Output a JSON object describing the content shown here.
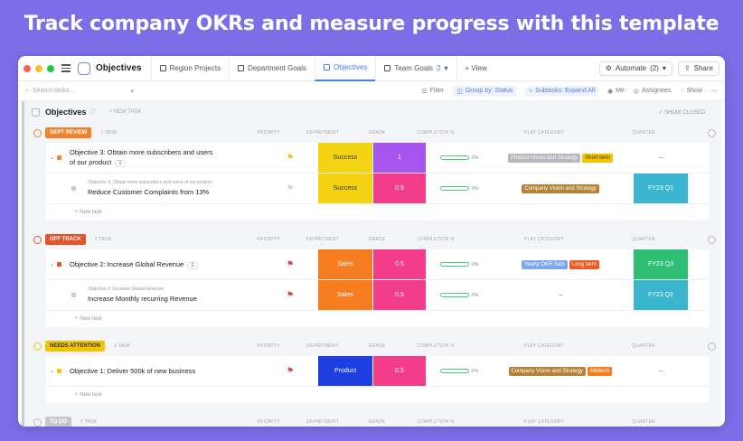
{
  "headline": "Track company OKRs and measure progress with this template",
  "colors": {
    "background": "#7b6ee6",
    "accent": "#4a7ef0"
  },
  "titlebar": {
    "app_title": "Objectives",
    "tabs": [
      "Region Projects",
      "Department Goals",
      "Objectives",
      "Team Goals"
    ],
    "team_goals_count": "2",
    "add_view": "+ View",
    "automate": "Automate",
    "automate_count": "(2)",
    "share": "Share"
  },
  "toolbar": {
    "search_placeholder": "Search tasks...",
    "filter": "Filter",
    "group_by": "Group by: Status",
    "subtasks": "Subtasks: Expand All",
    "me": "Me",
    "assignees": "Assignees",
    "show": "Show"
  },
  "list": {
    "title": "Objectives",
    "new_task": "+ NEW TASK",
    "show_closed": "SHOW CLOSED"
  },
  "columns": [
    "PRIORITY",
    "DEPARTMENT",
    "GRADE",
    "COMPLETION %",
    "PLAY CATEGORY",
    "QUARTER"
  ],
  "new_task_row": "+ New task",
  "groups": [
    {
      "status": "DEPT REVIEW",
      "color": "#f0822b",
      "count": "1 TASK",
      "rows": [
        {
          "parent": "",
          "name": "Objective 3: Obtain more subscribers and users",
          "name2": "of our product",
          "subcount": "1",
          "flag": "#f5c400",
          "department": "Success",
          "dept_color": "#f4d412",
          "dept_text": "#333",
          "grade": "1",
          "grade_color": "#a855f0",
          "completion": "0%",
          "categories": [
            {
              "label": "Product Vision and Strategy",
              "color": "#b7b7bd"
            },
            {
              "label": "Short term",
              "color": "#f5c400",
              "text": "#333"
            }
          ],
          "quarter": "–",
          "quarter_color": ""
        },
        {
          "parent": "Objective 3: Obtain more subscribers and users of our product",
          "name": "Reduce Customer Complaints from 13%",
          "name2": "",
          "subcount": "",
          "flag": "#cfcfd5",
          "department": "Success",
          "dept_color": "#f4d412",
          "dept_text": "#333",
          "grade": "0.5",
          "grade_color": "#f23d8a",
          "completion": "0%",
          "categories": [
            {
              "label": "Company Vision and Strategy",
              "color": "#b5823a"
            }
          ],
          "quarter": "FY23 Q1",
          "quarter_color": "#3bb4cf"
        }
      ]
    },
    {
      "status": "OFF TRACK",
      "color": "#e2552a",
      "count": "1 TASK",
      "rows": [
        {
          "parent": "",
          "name": "Objective 2: Increase Global Revenue",
          "name2": "",
          "subcount": "1",
          "flag": "#e53935",
          "department": "Sales",
          "dept_color": "#f57c1f",
          "dept_text": "#fff",
          "grade": "0.5",
          "grade_color": "#f23d8a",
          "completion": "0%",
          "categories": [
            {
              "label": "Yearly OKR Sets",
              "color": "#7aa7ef"
            },
            {
              "label": "Long term",
              "color": "#ec5a24"
            }
          ],
          "quarter": "FY23 Q3",
          "quarter_color": "#2fbf74"
        },
        {
          "parent": "Objective 2: Increase Global Revenue",
          "name": "Increase Monthly recurring Revenue",
          "name2": "",
          "subcount": "",
          "flag": "#e53935",
          "department": "Sales",
          "dept_color": "#f57c1f",
          "dept_text": "#fff",
          "grade": "0.5",
          "grade_color": "#f23d8a",
          "completion": "0%",
          "categories": [],
          "category_empty": "–",
          "quarter": "FY23 Q2",
          "quarter_color": "#3bb4cf"
        }
      ]
    },
    {
      "status": "NEEDS ATTENTION",
      "color": "#f5c400",
      "count": "1 TASK",
      "rows": [
        {
          "parent": "",
          "name": "Objective 1: Deliver 500k of new business",
          "name2": "",
          "subcount": "",
          "flag": "#e53935",
          "department": "Product",
          "dept_color": "#1e3fe0",
          "dept_text": "#fff",
          "grade": "0.5",
          "grade_color": "#f23d8a",
          "completion": "0%",
          "categories": [
            {
              "label": "Company Vision and Strategy",
              "color": "#b5823a"
            },
            {
              "label": "Midterm",
              "color": "#f57c1f"
            }
          ],
          "quarter": "–",
          "quarter_color": ""
        }
      ]
    }
  ],
  "todo_group": {
    "status": "TO DO",
    "count": "1 TASK"
  }
}
